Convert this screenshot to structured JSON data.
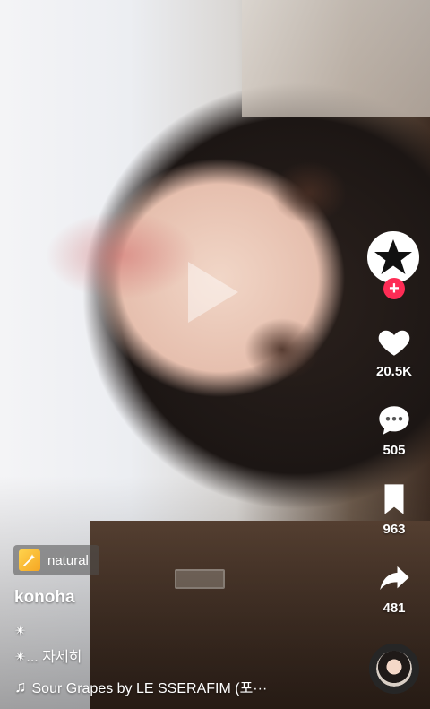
{
  "video": {
    "play_icon": "play-icon"
  },
  "creator": {
    "avatar_icon": "star-icon",
    "follow_label": "+"
  },
  "actions": {
    "likes": "20.5K",
    "comments": "505",
    "saves": "963",
    "shares": "481"
  },
  "effect": {
    "label": "natural",
    "icon": "sparkle-wand-icon"
  },
  "post": {
    "username": "konoha",
    "caption_line1": "✴",
    "caption_line2": "✴... 자세히"
  },
  "sound": {
    "icon": "music-note-icon",
    "title": "Sour Grapes by LE SSERAFIM (포···"
  },
  "colors": {
    "accent": "#fe2c55",
    "effect_icon": "#f5a623"
  }
}
